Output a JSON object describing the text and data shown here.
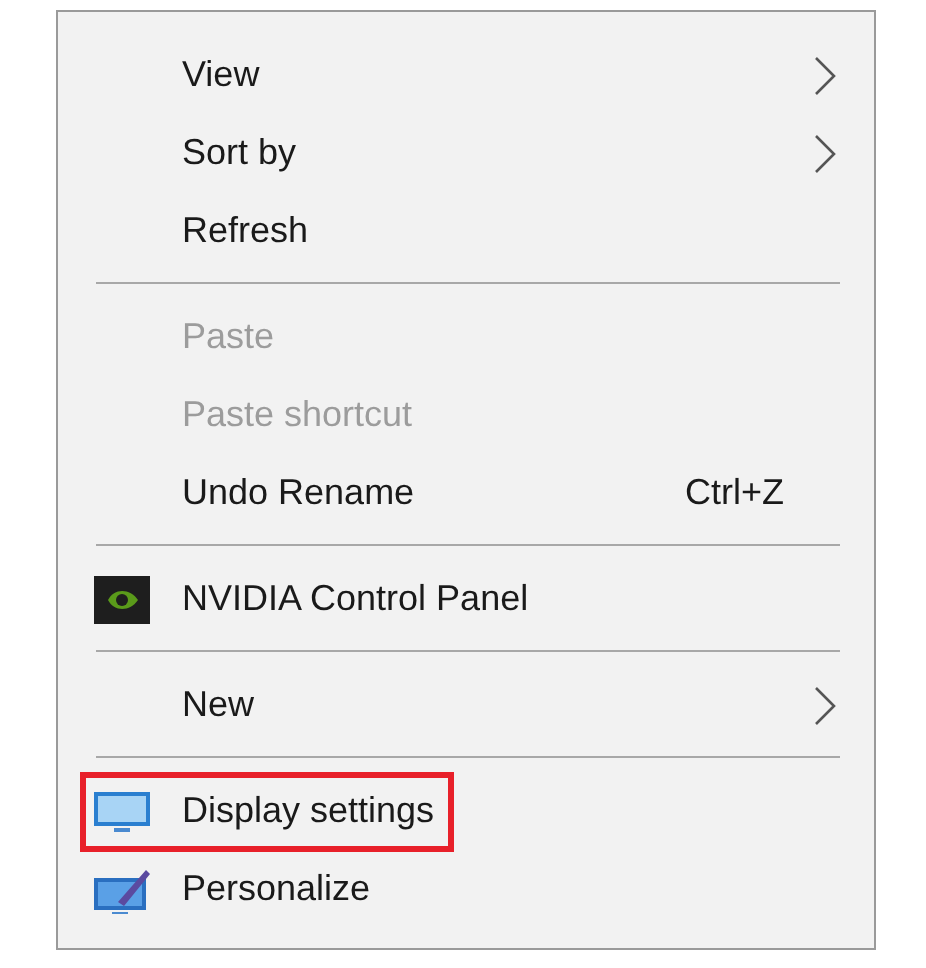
{
  "context_menu": {
    "items": [
      {
        "kind": "item",
        "label": "View",
        "submenu": true,
        "disabled": false,
        "highlighted": false
      },
      {
        "kind": "item",
        "label": "Sort by",
        "submenu": true,
        "disabled": false,
        "highlighted": false
      },
      {
        "kind": "item",
        "label": "Refresh",
        "submenu": false,
        "disabled": false,
        "highlighted": false
      },
      {
        "kind": "separator"
      },
      {
        "kind": "item",
        "label": "Paste",
        "submenu": false,
        "disabled": true,
        "highlighted": false
      },
      {
        "kind": "item",
        "label": "Paste shortcut",
        "submenu": false,
        "disabled": true,
        "highlighted": false
      },
      {
        "kind": "item",
        "label": "Undo Rename",
        "shortcut": "Ctrl+Z",
        "submenu": false,
        "disabled": false,
        "highlighted": false
      },
      {
        "kind": "separator"
      },
      {
        "kind": "gpu-app",
        "label": "NVIDIA Control Panel",
        "submenu": false,
        "disabled": false,
        "highlighted": false
      },
      {
        "kind": "separator"
      },
      {
        "kind": "item",
        "label": "New",
        "submenu": true,
        "disabled": false,
        "highlighted": false
      },
      {
        "kind": "separator"
      },
      {
        "kind": "display",
        "label": "Display settings",
        "submenu": false,
        "disabled": false,
        "highlighted": true
      },
      {
        "kind": "personalize",
        "label": "Personalize",
        "submenu": false,
        "disabled": false,
        "highlighted": false
      }
    ]
  }
}
